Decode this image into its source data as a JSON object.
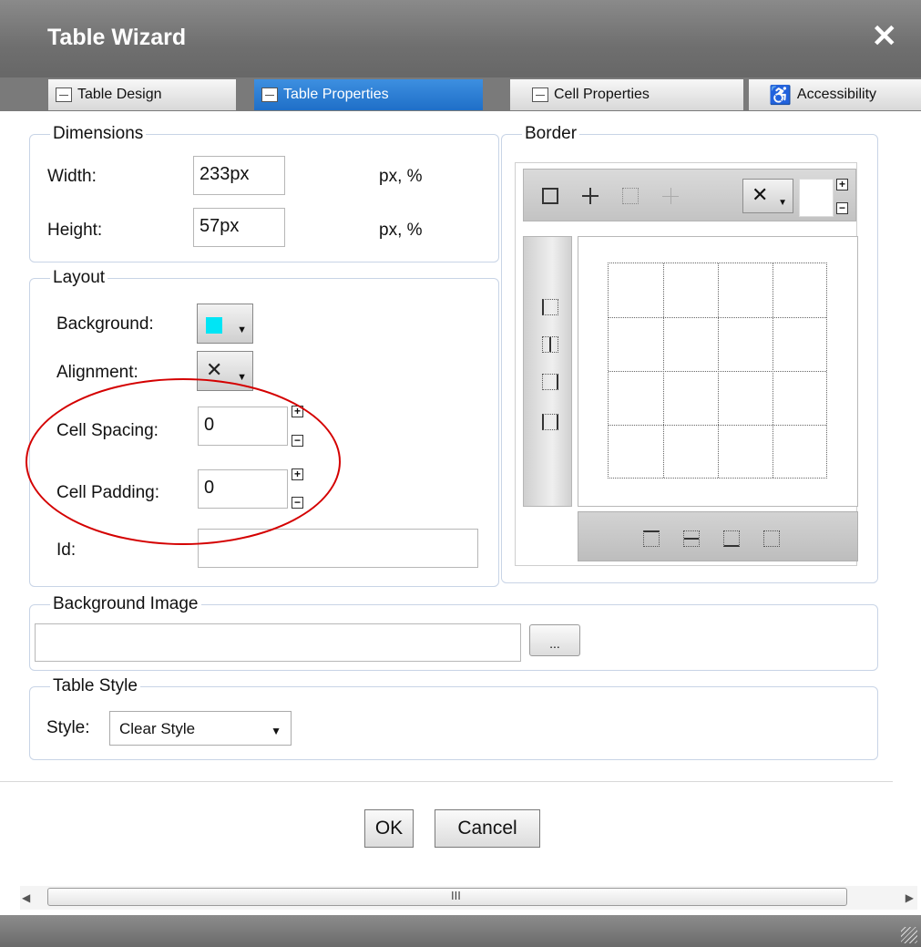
{
  "window": {
    "title": "Table Wizard",
    "close_glyph": "✕"
  },
  "tabs": [
    {
      "label": "Table Design",
      "active": false
    },
    {
      "label": "Table Properties",
      "active": true
    },
    {
      "label": "Cell Properties",
      "active": false
    },
    {
      "label": "Accessibility",
      "active": false
    }
  ],
  "dimensions": {
    "legend": "Dimensions",
    "width_label": "Width:",
    "width_value": "233px",
    "height_label": "Height:",
    "height_value": "57px",
    "unit_hint": "px, %"
  },
  "layout": {
    "legend": "Layout",
    "background_label": "Background:",
    "background_color": "#00e5f5",
    "alignment_label": "Alignment:",
    "cell_spacing_label": "Cell Spacing:",
    "cell_spacing_value": "0",
    "cell_padding_label": "Cell Padding:",
    "cell_padding_value": "0",
    "id_label": "Id:",
    "id_value": ""
  },
  "border": {
    "legend": "Border"
  },
  "background_image": {
    "legend": "Background Image",
    "value": "",
    "browse_label": "..."
  },
  "table_style": {
    "legend": "Table Style",
    "style_label": "Style:",
    "style_value": "Clear Style"
  },
  "buttons": {
    "ok": "OK",
    "cancel": "Cancel"
  },
  "scrollbar": {
    "thumb_grip": "III"
  },
  "colors": {
    "titlebar": "#777777",
    "active_tab": "#2a7ad6",
    "annotation": "#d40000"
  }
}
